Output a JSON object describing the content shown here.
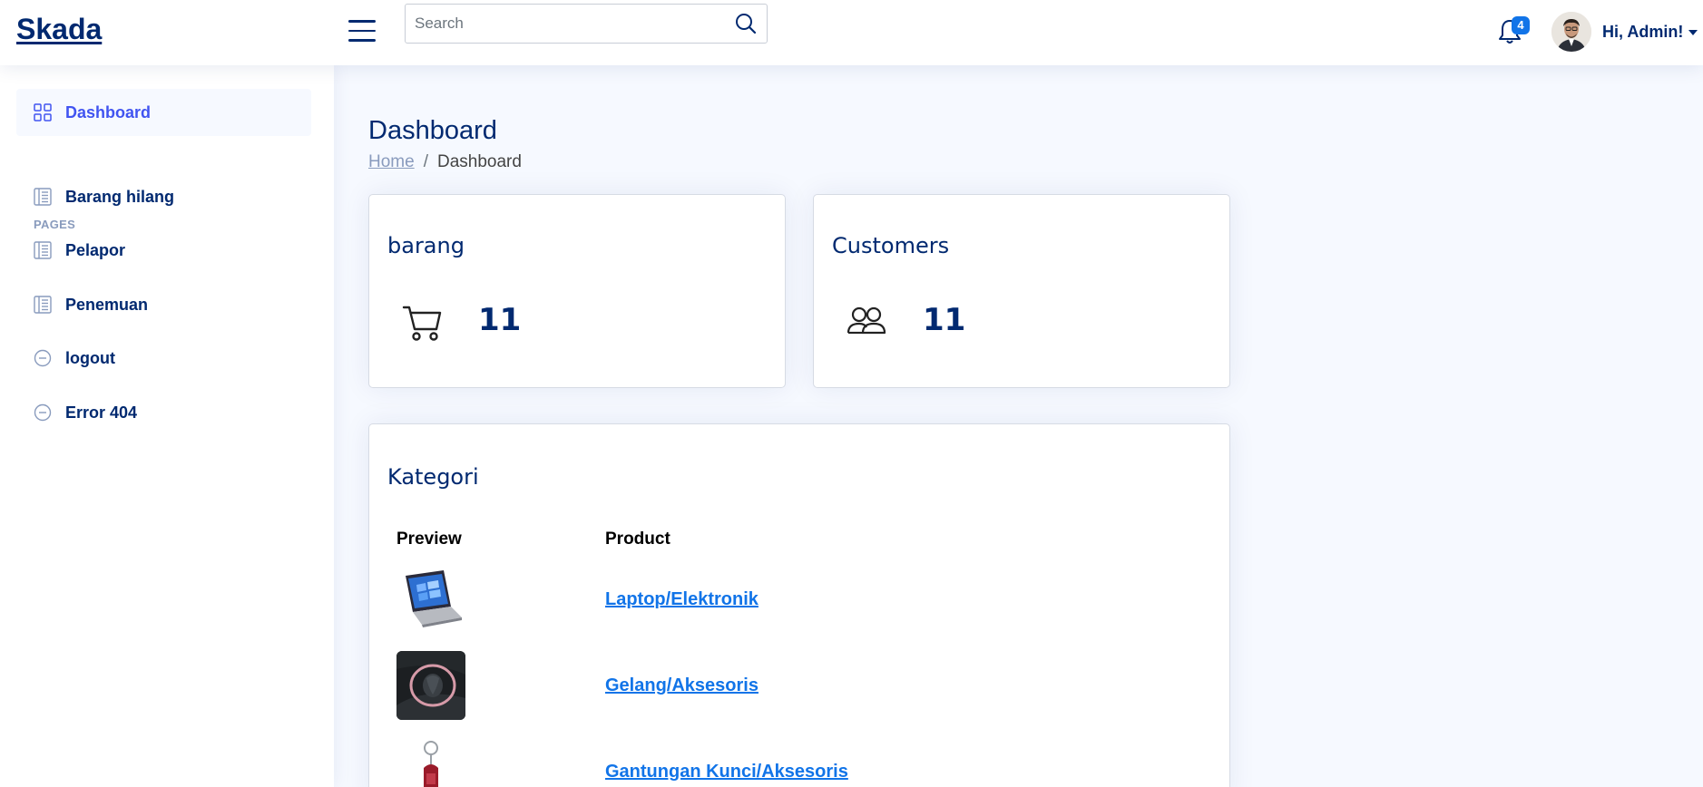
{
  "header": {
    "logo": "Skada",
    "search_placeholder": "Search",
    "notifications_count": "4",
    "profile_name": "Hi, Admin!"
  },
  "sidebar": {
    "items": [
      {
        "label": "Dashboard",
        "icon": "grid-icon"
      },
      {
        "label": "Barang hilang",
        "icon": "layout-text-sidebar-icon"
      },
      {
        "label": "Pelapor",
        "icon": "layout-text-sidebar-icon"
      },
      {
        "label": "Penemuan",
        "icon": "layout-text-sidebar-icon"
      },
      {
        "label": "logout",
        "icon": "dash-circle-icon"
      },
      {
        "label": "Error 404",
        "icon": "dash-circle-icon"
      }
    ],
    "heading": "PAGES"
  },
  "main": {
    "title": "Dashboard",
    "breadcrumb": {
      "home": "Home",
      "separator": "/",
      "current": "Dashboard"
    },
    "cards": [
      {
        "title": "barang",
        "value": "11",
        "icon": "cart-icon"
      },
      {
        "title": "Customers",
        "value": "11",
        "icon": "people-icon"
      }
    ],
    "kategori": {
      "title": "Kategori",
      "columns": [
        "Preview",
        "Product"
      ],
      "rows": [
        {
          "product": "Laptop/Elektronik",
          "preview": "laptop-thumbnail"
        },
        {
          "product": "Gelang/Aksesoris",
          "preview": "bracelet-thumbnail"
        },
        {
          "product": "Gantungan Kunci/Aksesoris",
          "preview": "keychain-thumbnail"
        }
      ]
    }
  },
  "colors": {
    "primary": "#012970",
    "accent": "#4154f1",
    "link": "#1174e8",
    "background": "#f6f9ff"
  }
}
